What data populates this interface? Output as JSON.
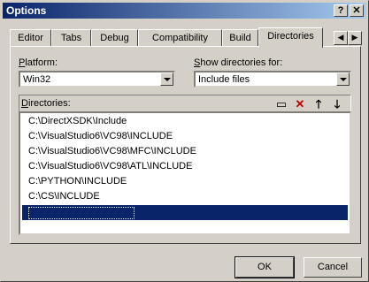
{
  "window": {
    "title": "Options",
    "help_label": "?",
    "close_label": "✕"
  },
  "tabs": [
    {
      "label": "Editor",
      "active": false
    },
    {
      "label": "Tabs",
      "active": false
    },
    {
      "label": "Debug",
      "active": false
    },
    {
      "label": "Compatibility",
      "active": false
    },
    {
      "label": "Build",
      "active": false
    },
    {
      "label": "Directories",
      "active": true
    }
  ],
  "tab_scroll": {
    "left": "◀",
    "right": "▶"
  },
  "platform": {
    "label_prefix": "P",
    "label_rest": "latform:",
    "value": "Win32"
  },
  "show_dirs": {
    "label_prefix": "S",
    "label_rest": "how directories for:",
    "value": "Include files"
  },
  "directories": {
    "label_prefix": "D",
    "label_rest": "irectories:",
    "toolbar": [
      {
        "icon": "new-folder-icon",
        "glyph": "▭"
      },
      {
        "icon": "delete-icon",
        "glyph": "✕"
      },
      {
        "icon": "move-up-icon",
        "glyph": "🡑"
      },
      {
        "icon": "move-down-icon",
        "glyph": "🡓"
      }
    ],
    "items": [
      "C:\\DirectXSDK\\Include",
      "C:\\VisualStudio6\\VC98\\INCLUDE",
      "C:\\VisualStudio6\\VC98\\MFC\\INCLUDE",
      "C:\\VisualStudio6\\VC98\\ATL\\INCLUDE",
      "C:\\PYTHON\\INCLUDE",
      "C:\\CS\\INCLUDE",
      ""
    ],
    "selected_index": 6
  },
  "buttons": {
    "ok": "OK",
    "cancel": "Cancel"
  },
  "colors": {
    "selection": "#0a246a",
    "title_start": "#0a246a",
    "face": "#d4d0c8",
    "delete": "#c00000"
  }
}
